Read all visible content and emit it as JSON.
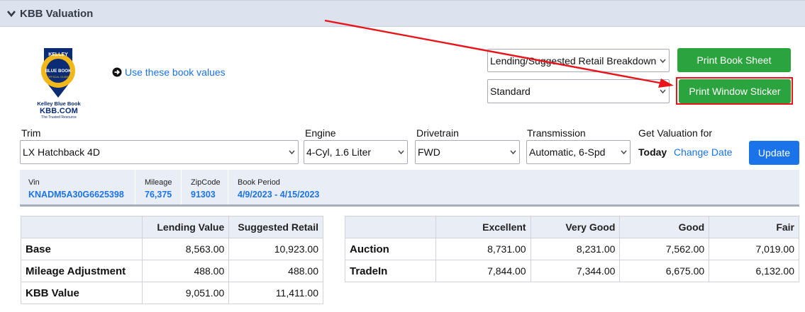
{
  "header": {
    "title": "KBB Valuation"
  },
  "logo": {
    "brand_line": "Kelley Blue Book",
    "domain": "KBB.COM",
    "tagline": "The Trusted Resource",
    "shield_top": "KELLEY",
    "shield_mid": "BLUE BOOK",
    "shield_bot": "OFFICIAL GUIDE"
  },
  "use_values_link": "Use these book values",
  "selects": {
    "report_type": "Lending/Suggested Retail Breakdown",
    "sticker_type": "Standard",
    "trim": "LX Hatchback 4D",
    "engine": "4-Cyl, 1.6 Liter",
    "drivetrain": "FWD",
    "transmission": "Automatic, 6-Spd"
  },
  "buttons": {
    "print_book_sheet": "Print Book Sheet",
    "print_window_sticker": "Print Window Sticker",
    "update": "Update"
  },
  "labels": {
    "trim": "Trim",
    "engine": "Engine",
    "drivetrain": "Drivetrain",
    "transmission": "Transmission",
    "get_valuation_for": "Get Valuation for"
  },
  "valuation_date": {
    "today": "Today",
    "change_date": "Change Date"
  },
  "vehicle_info": {
    "vin_label": "Vin",
    "vin": "KNADM5A30G6625398",
    "mileage_label": "Mileage",
    "mileage": "76,375",
    "zip_label": "ZipCode",
    "zip": "91303",
    "period_label": "Book Period",
    "period": "4/9/2023 - 4/15/2023"
  },
  "lending_table": {
    "headers": [
      "",
      "Lending Value",
      "Suggested Retail"
    ],
    "rows": [
      {
        "label": "Base",
        "lending": "8,563.00",
        "retail": "10,923.00"
      },
      {
        "label": "Mileage Adjustment",
        "lending": "488.00",
        "retail": "488.00"
      },
      {
        "label": "KBB Value",
        "lending": "9,051.00",
        "retail": "11,411.00"
      }
    ]
  },
  "condition_table": {
    "headers": [
      "",
      "Excellent",
      "Very Good",
      "Good",
      "Fair"
    ],
    "rows": [
      {
        "label": "Auction",
        "values": [
          "8,731.00",
          "8,231.00",
          "7,562.00",
          "7,019.00"
        ]
      },
      {
        "label": "TradeIn",
        "values": [
          "7,844.00",
          "7,344.00",
          "6,675.00",
          "6,132.00"
        ]
      }
    ]
  },
  "colors": {
    "accent_blue": "#1a73e8",
    "green": "#2ba33e",
    "highlight_red": "#e8141a",
    "header_bg": "#dde3ee"
  }
}
